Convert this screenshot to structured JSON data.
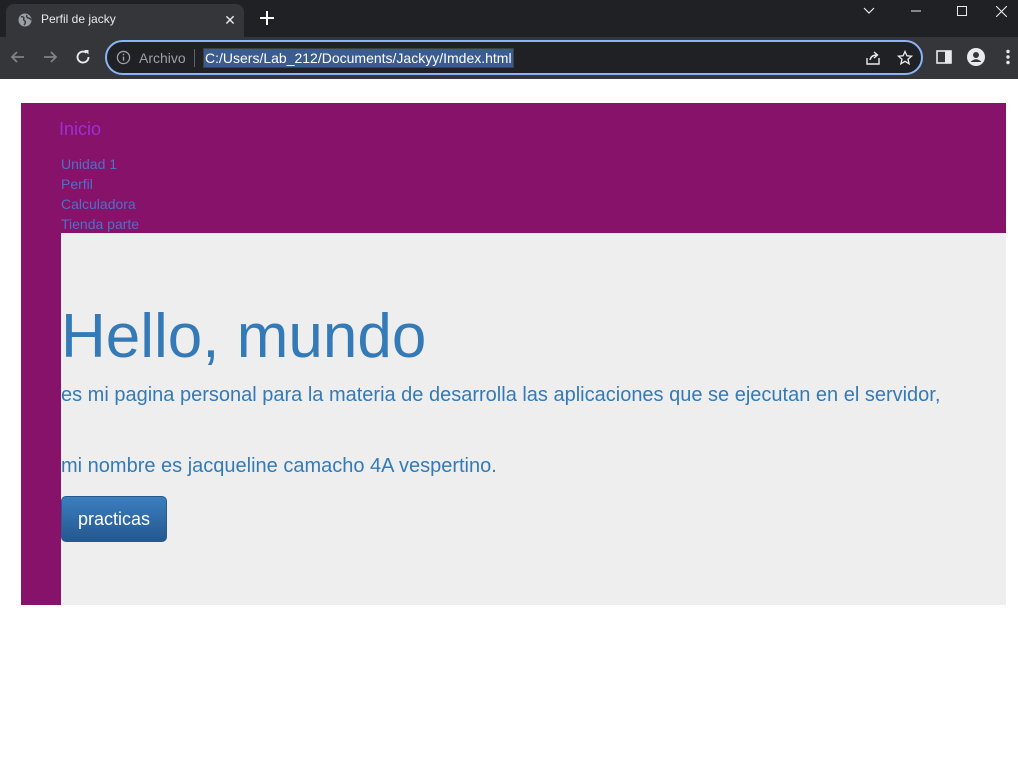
{
  "browser": {
    "tab_title": "Perfil de jacky",
    "tab_close_glyph": "✕",
    "new_tab_icon": "plus-icon",
    "scheme_label": "Archivo",
    "url": "C:/Users/Lab_212/Documents/Jackyy/Imdex.html",
    "icons": [
      "globe-icon",
      "back-arrow-icon",
      "forward-arrow-icon",
      "reload-icon",
      "info-icon",
      "share-icon",
      "star-icon",
      "side-panel-icon",
      "profile-icon",
      "menu-icon",
      "chevron-down-icon",
      "minimize-icon",
      "maximize-icon",
      "close-icon"
    ],
    "accent_color": "#8ab4f8"
  },
  "site": {
    "brand": "Inicio",
    "nav_items": [
      "Unidad 1",
      "Perfil",
      "Calculadora",
      "Tienda parte"
    ],
    "hero_title": "Hello, mundo",
    "hero_line1": "es mi pagina personal para la materia de desarrolla las aplicaciones que se ejecutan en el servidor,",
    "hero_line2": "mi nombre es jacqueline camacho 4A vespertino.",
    "button_label": "practicas",
    "colors": {
      "frame": "#861269",
      "jumbotron": "#eeeeee",
      "text": "#337ab7",
      "brand": "#9d2fd6",
      "nav_link": "#4f6fc9"
    }
  }
}
